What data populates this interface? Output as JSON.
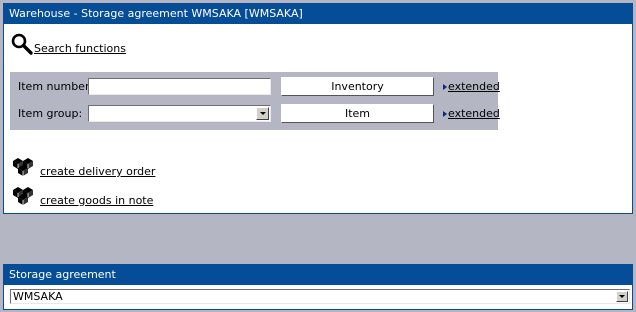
{
  "warehouse_panel": {
    "title": "Warehouse - Storage agreement WMSAKA [WMSAKA]",
    "search_link_label": "Search functions",
    "search": {
      "item_number_label": "Item number:",
      "item_number_value": "",
      "inventory_button": "Inventory",
      "item_group_label": "Item group:",
      "item_group_value": "",
      "item_button": "Item",
      "extended_label": "extended"
    },
    "actions": [
      {
        "label": "create delivery order",
        "icon": "boxes-icon"
      },
      {
        "label": "create goods in note",
        "icon": "boxes-icon"
      }
    ]
  },
  "storage_panel": {
    "title": "Storage agreement",
    "selected_value": "WMSAKA"
  },
  "colors": {
    "titlebar": "#064d97",
    "background": "#b4b6c4",
    "search_box": "#b4b6c4"
  }
}
